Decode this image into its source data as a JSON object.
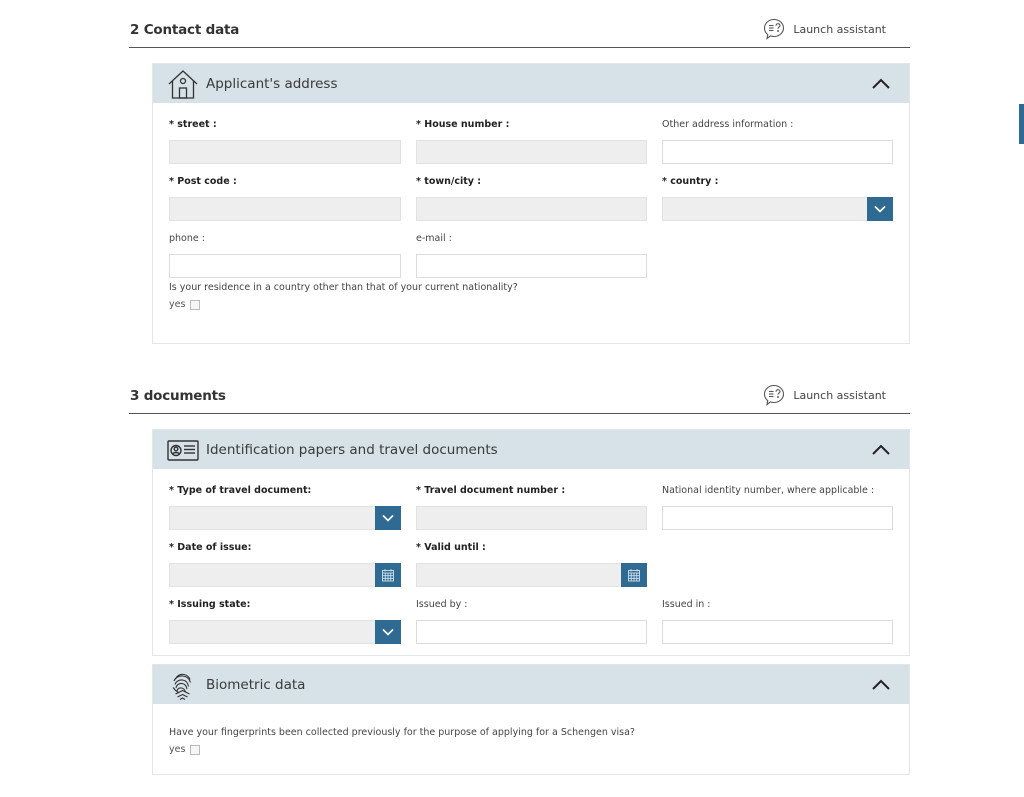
{
  "sections": [
    {
      "title": "2 Contact data",
      "assistant_label": "Launch assistant",
      "panels": [
        {
          "title": "Applicant's address",
          "icon": "house-icon",
          "fields": {
            "street": {
              "label": "* street :"
            },
            "house_number": {
              "label": "* House number :"
            },
            "other_address": {
              "label": "Other address information :",
              "value": ""
            },
            "post_code": {
              "label": "* Post code :"
            },
            "town_city": {
              "label": "* town/city :"
            },
            "country": {
              "label": "* country :",
              "value": ""
            },
            "phone": {
              "label": "phone :",
              "value": ""
            },
            "email": {
              "label": "e-mail :",
              "value": ""
            }
          },
          "question": "Is your residence in a country other than that of your current nationality?",
          "yes_label": "yes"
        }
      ]
    },
    {
      "title": "3 documents",
      "assistant_label": "Launch assistant",
      "panels": [
        {
          "title": "Identification papers and travel documents",
          "icon": "id-card-icon",
          "fields": {
            "doc_type": {
              "label": "* Type of travel document:",
              "value": ""
            },
            "doc_number": {
              "label": "* Travel document number :"
            },
            "national_id": {
              "label": "National identity number, where applicable :",
              "value": ""
            },
            "date_issue": {
              "label": "* Date of issue:"
            },
            "valid_until": {
              "label": "* Valid until :"
            },
            "issuing_state": {
              "label": "* Issuing state:",
              "value": ""
            },
            "issued_by": {
              "label": "Issued by :",
              "value": ""
            },
            "issued_in": {
              "label": "Issued in :",
              "value": ""
            }
          }
        },
        {
          "title": "Biometric data",
          "icon": "fingerprint-icon",
          "question": "Have your fingerprints been collected previously for the purpose of applying for a Schengen visa?",
          "yes_label": "yes"
        }
      ]
    }
  ],
  "colors": {
    "accent": "#2f6a93",
    "panel_header": "#d6e1e8",
    "disabled_input": "#eeeeee"
  }
}
